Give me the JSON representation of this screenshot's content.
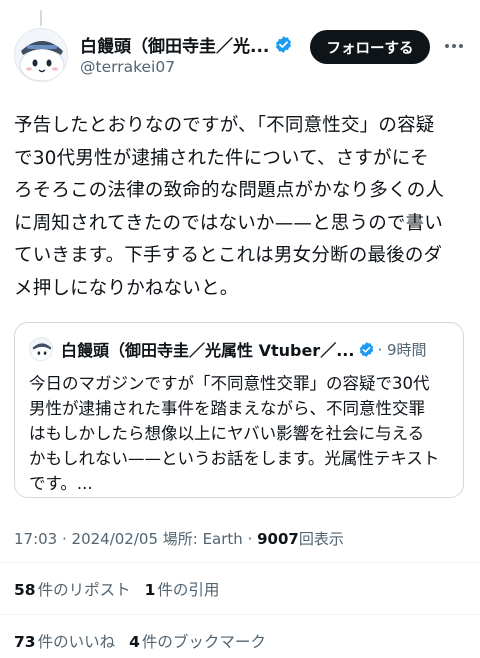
{
  "author": {
    "display_name": "白饅頭（御田寺圭／光...",
    "handle": "@terrakei07",
    "follow_label": "フォローする",
    "verified_icon": "verified-badge-icon",
    "verified_color": "#1d9bf0"
  },
  "tweet": {
    "text": "予告したとおりなのですが、「不同意性交」の容疑\nで30代男性が逮捕された件について、さすがにそ\nろそろこの法律の致命的な問題点がかなり多くの人\nに周知されてきたのではないか——と思うので書い\nていきます。下手するとこれは男女分断の最後のダ\nメ押しになりかねないと。"
  },
  "quoted": {
    "display_name": "白饅頭（御田寺圭／光属性 Vtuber／...",
    "time": "· 9時間",
    "text": "今日のマガジンですが「不同意性交罪」の容疑で30代\n男性が逮捕された事件を踏まえながら、不同意性交罪\nはもしかしたら想像以上にヤバい影響を社会に与える\nかもしれない——というお話をします。光属性テキスト\nです。..."
  },
  "meta": {
    "time": "17:03 · 2024/02/05 場所: Earth · ",
    "views": "9007",
    "views_label": "回表示"
  },
  "stats": {
    "reposts": "58",
    "reposts_label": "件のリポスト",
    "quotes": "1",
    "quotes_label": "件の引用",
    "likes": "73",
    "likes_label": "件のいいね",
    "bookmarks": "4",
    "bookmarks_label": "件のブックマーク"
  },
  "colors": {
    "text": "#0f1419",
    "secondary": "#536471",
    "border": "#cfd9de",
    "follow_bg": "#0f1419"
  }
}
